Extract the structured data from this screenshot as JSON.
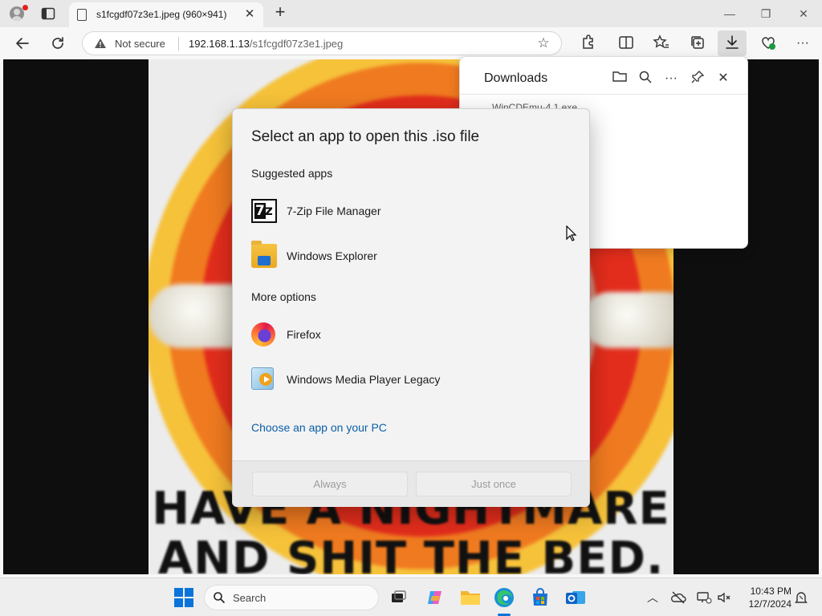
{
  "browser": {
    "tab_title": "s1fcgdf07z3e1.jpeg (960×941)",
    "new_tab_symbol": "+",
    "address": {
      "security_label": "Not secure",
      "host": "192.168.1.13",
      "path": "/s1fcgdf07z3e1.jpeg"
    }
  },
  "image_text": {
    "line1": "HAVE A NIGHTMARE",
    "line2": "AND SHIT THE BED."
  },
  "downloads_panel": {
    "title": "Downloads",
    "partial_item": "WinCDEmu-4.1.exe"
  },
  "dialog": {
    "title": "Select an app to open this .iso file",
    "suggested_label": "Suggested apps",
    "suggested_apps": [
      {
        "label": "7-Zip File Manager",
        "icon": "7zip-icon"
      },
      {
        "label": "Windows Explorer",
        "icon": "folder-icon"
      }
    ],
    "more_label": "More options",
    "more_apps": [
      {
        "label": "Firefox",
        "icon": "firefox-icon"
      },
      {
        "label": "Windows Media Player Legacy",
        "icon": "media-player-icon"
      }
    ],
    "choose_link": "Choose an app on your PC",
    "always_button": "Always",
    "just_once_button": "Just once"
  },
  "taskbar": {
    "search_placeholder": "Search",
    "time": "10:43 PM",
    "date": "12/7/2024"
  },
  "colors": {
    "accent": "#0a74da",
    "link": "#0a5fa8",
    "disabled_text": "#9c9c9c"
  }
}
